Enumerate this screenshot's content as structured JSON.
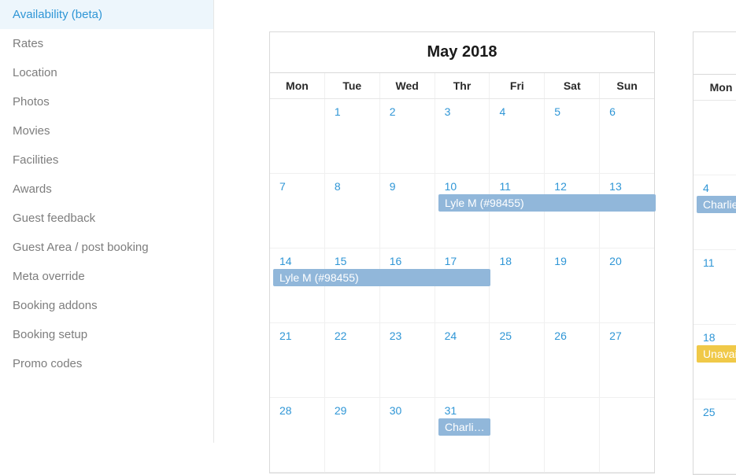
{
  "sidebar": {
    "items": [
      {
        "label": "Availability (beta)",
        "active": true
      },
      {
        "label": "Rates"
      },
      {
        "label": "Location"
      },
      {
        "label": "Photos"
      },
      {
        "label": "Movies"
      },
      {
        "label": "Facilities"
      },
      {
        "label": "Awards"
      },
      {
        "label": "Guest feedback"
      },
      {
        "label": "Guest Area / post booking"
      },
      {
        "label": "Meta override"
      },
      {
        "label": "Booking addons"
      },
      {
        "label": "Booking setup"
      },
      {
        "label": "Promo codes"
      }
    ]
  },
  "calendar_main": {
    "month": "May 2018",
    "day_headers": [
      "Mon",
      "Tue",
      "Wed",
      "Thr",
      "Fri",
      "Sat",
      "Sun"
    ],
    "weeks": [
      [
        "",
        "1",
        "2",
        "3",
        "4",
        "5",
        "6"
      ],
      [
        "7",
        "8",
        "9",
        "10",
        "11",
        "12",
        "13"
      ],
      [
        "14",
        "15",
        "16",
        "17",
        "18",
        "19",
        "20"
      ],
      [
        "21",
        "22",
        "23",
        "24",
        "25",
        "26",
        "27"
      ],
      [
        "28",
        "29",
        "30",
        "31",
        "",
        "",
        ""
      ]
    ],
    "events": [
      {
        "id": "lyle-1",
        "label": "Lyle M (#98455)",
        "row": 1,
        "col_start": 3,
        "col_end": 7,
        "color": "blue"
      },
      {
        "id": "lyle-2",
        "label": "Lyle M (#98455)",
        "row": 2,
        "col_start": 0,
        "col_end": 4,
        "color": "blue"
      },
      {
        "id": "charlie",
        "label": "Charlie …",
        "row": 4,
        "col_start": 3,
        "col_end": 4,
        "color": "blue"
      }
    ]
  },
  "calendar_next": {
    "day_headers": [
      "Mon"
    ],
    "weeks": [
      [
        ""
      ],
      [
        "4"
      ],
      [
        "11"
      ],
      [
        "18"
      ],
      [
        "25"
      ]
    ],
    "events": [
      {
        "id": "charlie-next",
        "label": "Charlie",
        "row": 1,
        "col_start": 0,
        "col_end": 1,
        "color": "blue"
      },
      {
        "id": "unavail",
        "label": "Unavail",
        "row": 3,
        "col_start": 0,
        "col_end": 1,
        "color": "yellow"
      }
    ]
  }
}
